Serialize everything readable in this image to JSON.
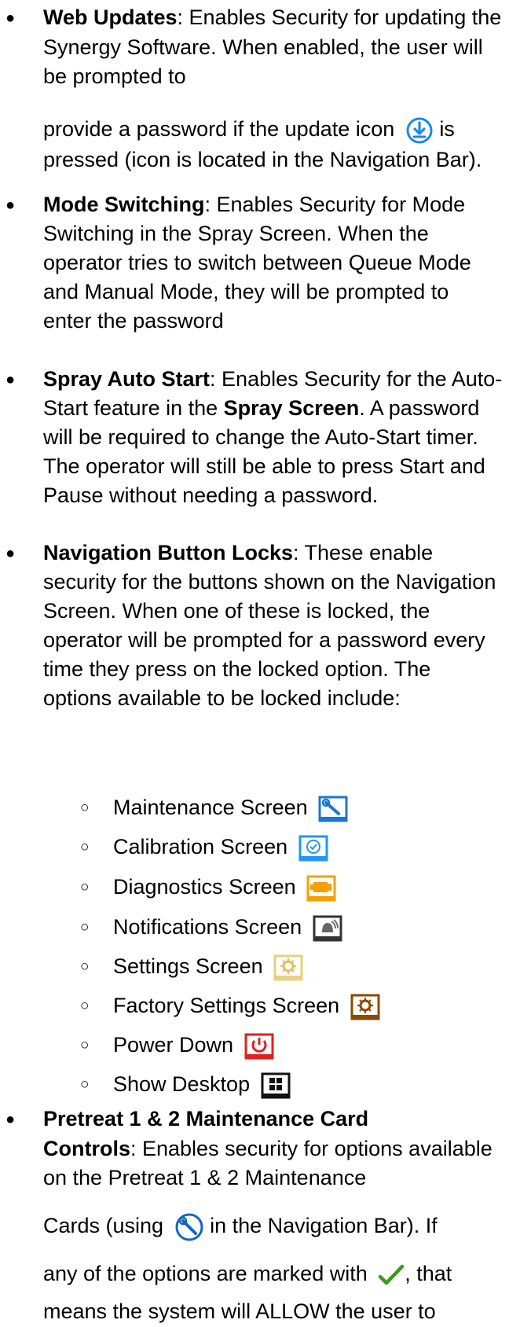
{
  "bullets": {
    "web_updates": {
      "title": "Web Updates",
      "text1": ": Enables Security for updating the Synergy Software. When enabled, the user will be prompted to",
      "text2": "provide a password if the update icon",
      "text3": "is pressed (icon is located in the Navigation Bar)."
    },
    "mode_switching": {
      "title": "Mode Switching",
      "text": ": Enables Security for Mode Switching in the Spray Screen.  When the operator tries to switch between Queue Mode and Manual Mode, they will be prompted to enter the password"
    },
    "spray_auto_start": {
      "title": "Spray Auto Start",
      "text1": ": Enables Security for the Auto-Start feature in the ",
      "bold2": "Spray Screen",
      "text2": ". A password will be required to change the Auto-Start timer. The operator will still be able to press Start and Pause without needing a password."
    },
    "nav_locks": {
      "title": "Navigation Button Locks",
      "text": ": These enable security for the buttons shown on the Navigation Screen. When one of these is locked, the operator will be prompted for a password every time they press on the locked option. The options available to be locked include:",
      "items": [
        {
          "label": "Maintenance Screen",
          "icon": "wrench-icon"
        },
        {
          "label": "Calibration Screen",
          "icon": "calibration-icon"
        },
        {
          "label": "Diagnostics Screen",
          "icon": "engine-icon"
        },
        {
          "label": "Notifications Screen",
          "icon": "bell-icon"
        },
        {
          "label": "Settings Screen",
          "icon": "gear-icon"
        },
        {
          "label": "Factory Settings Screen",
          "icon": "factory-gear-icon"
        },
        {
          "label": "Power Down",
          "icon": "power-icon"
        },
        {
          "label": "Show Desktop",
          "icon": "windows-icon"
        }
      ]
    },
    "pretreat": {
      "title1": "Pretreat 1 & 2 Maintenance Card",
      "title2": "Controls",
      "text1": ": Enables security for options available on the Pretreat 1 & 2 Maintenance",
      "text2": "Cards (using",
      "text3": "in the Navigation Bar). If",
      "text4": "any of the options are marked with",
      "text5": ", that",
      "text6": "means the system will ALLOW the user to"
    }
  },
  "markers": {
    "bullet": "●",
    "sub": "○"
  },
  "colors": {
    "update": "#1e88e5",
    "maintenance": "#1976d2",
    "calibration": "#2196f3",
    "diagnostics": "#f5a000",
    "notifications": "#555555",
    "settings": "#e8d080",
    "factory": "#8a4a00",
    "power": "#e02020",
    "desktop": "#111111",
    "check": "#3a9a1a"
  }
}
